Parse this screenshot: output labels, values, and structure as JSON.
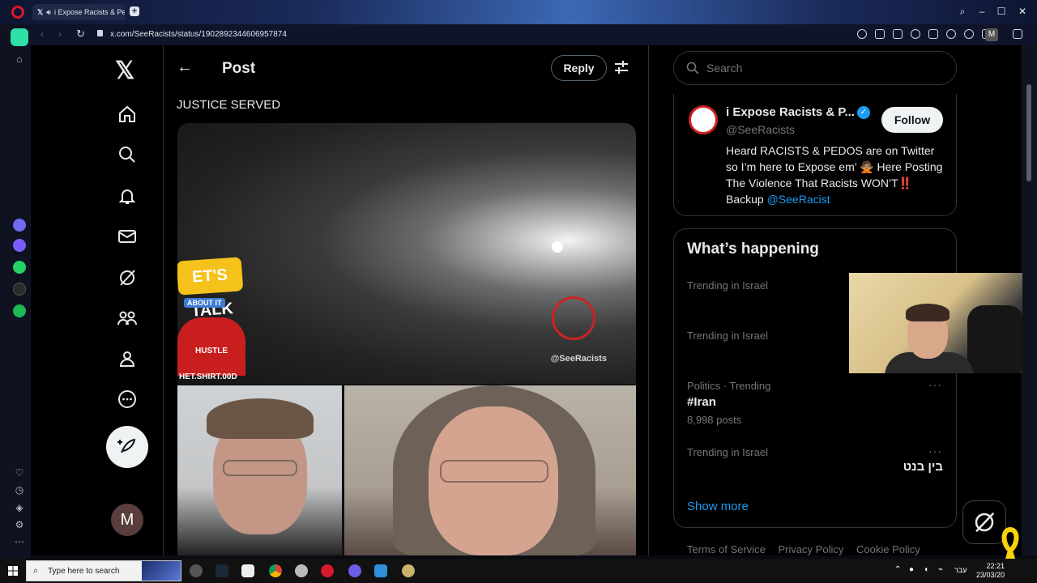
{
  "browser": {
    "tab_title": "i Expose Racists & Pe...",
    "tab_x": "𝕏",
    "url": "x.com/SeeRacists/status/1902892344606957874",
    "profile_initial": "M"
  },
  "nav": {
    "logo": "𝕏",
    "avatar_initial": "M"
  },
  "post": {
    "header_title": "Post",
    "reply_label": "Reply",
    "text": "JUSTICE SERVED",
    "video_badge": "ET'S TALK",
    "video_badge_sub": "ABOUT IT",
    "video_hustle": "HUSTLE",
    "video_shirt": "HET.SHIRT.00D",
    "video_handle": "@SeeRacists"
  },
  "search": {
    "placeholder": "Search"
  },
  "profile_card": {
    "name": "i Expose Racists & P...",
    "handle": "@SeeRacists",
    "follow_label": "Follow",
    "bio_main": "Heard RACISTS & PEDOS are on Twitter so I’m here to Expose em’ 🙅🏽 Here Posting The Violence That Racists WON’T",
    "bio_emphasis": "‼️",
    "bio_suffix": " Backup ",
    "bio_mention": "@SeeRacist"
  },
  "happening": {
    "title": "What’s happening",
    "trends": [
      {
        "meta": "Trending in Israel"
      },
      {
        "meta": "Trending in Israel"
      },
      {
        "meta": "Politics · Trending",
        "topic": "#Iran",
        "posts": "8,998 posts"
      },
      {
        "meta": "Trending in Israel",
        "topic": "בין בנט"
      }
    ],
    "more_glyph": "···",
    "show_more": "Show more"
  },
  "footer": {
    "links": [
      "Terms of Service",
      "Privacy Policy",
      "Cookie Policy"
    ]
  },
  "taskbar": {
    "search_text": "Type here to search",
    "time": "22:21",
    "date": "23/03/20",
    "lang": "עבר"
  },
  "colors": {
    "accent": "#1d9bf0",
    "background": "#000000",
    "border": "#2f3336",
    "muted_text": "#71767b"
  }
}
